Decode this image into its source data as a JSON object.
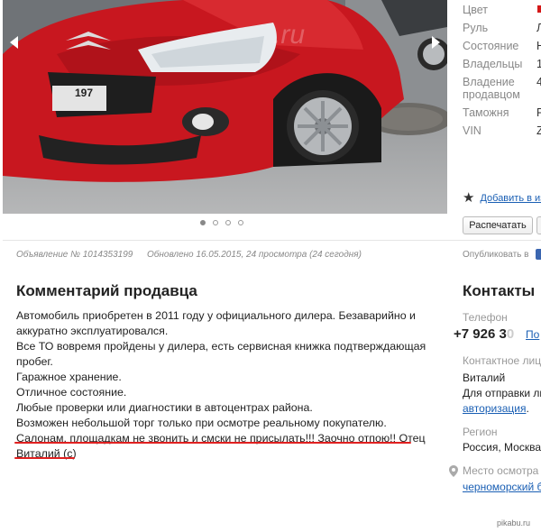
{
  "gallery": {
    "plate_text": "197",
    "watermark": ".ru",
    "dots": [
      true,
      false,
      false,
      false
    ]
  },
  "specs": [
    {
      "label": "Цвет",
      "value": ""
    },
    {
      "label": "Руль",
      "value": "Л"
    },
    {
      "label": "Состояние",
      "value": "Н"
    },
    {
      "label": "Владельцы",
      "value": "1"
    },
    {
      "label": "Владение\nпродавцом",
      "value": "4"
    },
    {
      "label": "Таможня",
      "value": "Р"
    },
    {
      "label": "VIN",
      "value": "Z"
    }
  ],
  "spec_color": "#d41818",
  "actions": {
    "favorite_label": "Добавить в из",
    "print_label": "Распечатать"
  },
  "meta": {
    "ad_number": "Объявление № 1014353199",
    "updated": "Обновлено 16.05.2015, 24 просмотра (24 сегодня)",
    "published": "Опубликовать в"
  },
  "comment": {
    "title": "Комментарий продавца",
    "lines": [
      "Автомобиль приобретен в 2011 году у официального дилера. Безаварийно и",
      "аккуратно эксплуатировался.",
      "Все ТО вовремя пройдены у дилера, есть сервисная книжка подтверждающая",
      "пробег.",
      "Гаражное хранение.",
      "Отличное состояние.",
      "Любые проверки или диагностики в автоцентрах района.",
      "Возможен небольшой торг только при осмотре реальному покупателю.",
      "Салонам, площадкам не звонить и смски не присылать!!! Заочно отпою!! Отец",
      "Виталий (с)"
    ]
  },
  "contacts": {
    "title": "Контакты",
    "phone_label": "Телефон",
    "phone_prefix": "+",
    "phone_visible": "7 926 3",
    "phone_faded": "0",
    "show_label": "По",
    "person_label": "Контактное лицо",
    "person_name": "Виталий",
    "sms_text": "Для отправки ли",
    "auth_link": "авторизация",
    "auth_suffix": ".",
    "region_label": "Регион",
    "region_value": "Россия, Москва",
    "inspection_label": "Место осмотра",
    "inspection_value": "черноморский б"
  },
  "footer": {
    "watermark": "pikabu.ru"
  }
}
